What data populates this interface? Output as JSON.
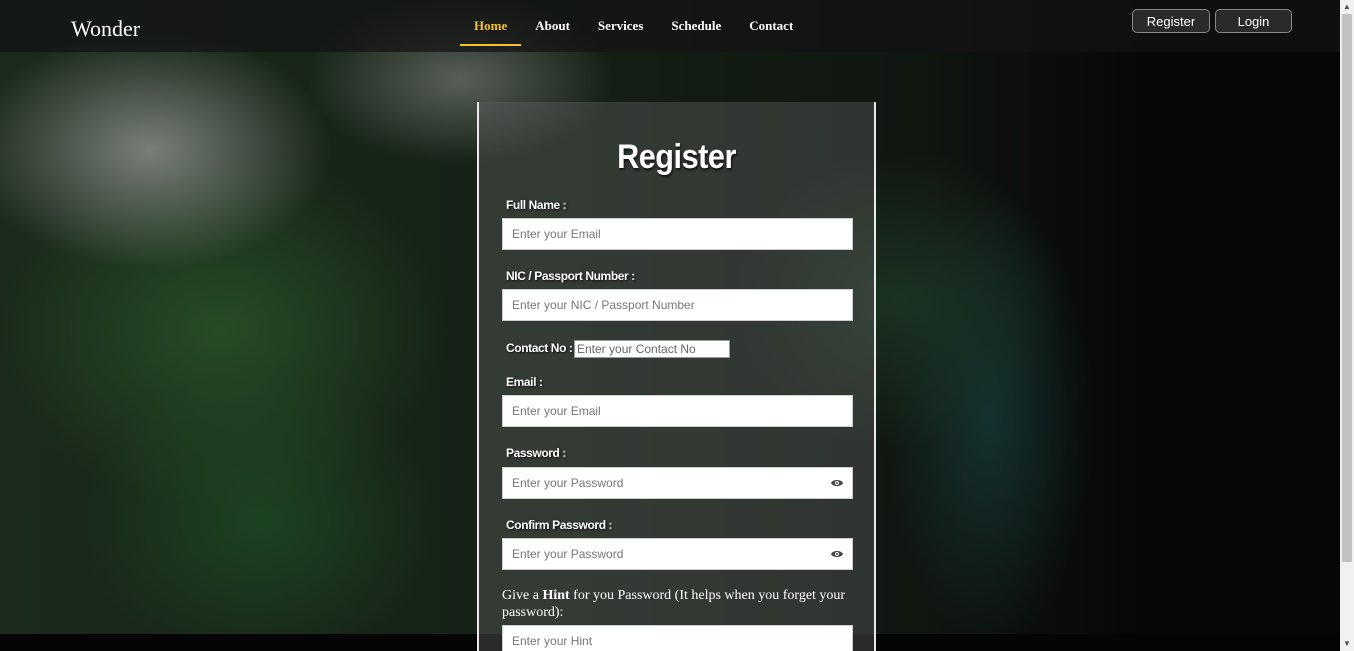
{
  "navbar": {
    "brand": "Wonder",
    "links": [
      "Home",
      "About",
      "Services",
      "Schedule",
      "Contact"
    ],
    "active_link": "Home",
    "register_label": "Register",
    "login_label": "Login",
    "accent_color": "#f4c12a"
  },
  "form": {
    "title": "Register",
    "full_name": {
      "label": "Full Name :",
      "placeholder": "Enter your Email"
    },
    "nic": {
      "label": "NIC / Passport Number :",
      "placeholder": "Enter your NIC / Passport Number"
    },
    "contact": {
      "label": "Contact No :",
      "placeholder": "Enter your Contact No"
    },
    "email": {
      "label": "Email :",
      "placeholder": "Enter your Email"
    },
    "password": {
      "label": "Password :",
      "placeholder": "Enter your Password",
      "toggle_icon": "eye-icon"
    },
    "confirm_password": {
      "label": "Confirm Password :",
      "placeholder": "Enter your Password",
      "toggle_icon": "eye-icon"
    },
    "hint": {
      "prefix": "Give a",
      "bold": "Hint",
      "suffix": "for you Password (It helps when you forget your password):",
      "placeholder": "Enter your Hint"
    }
  }
}
